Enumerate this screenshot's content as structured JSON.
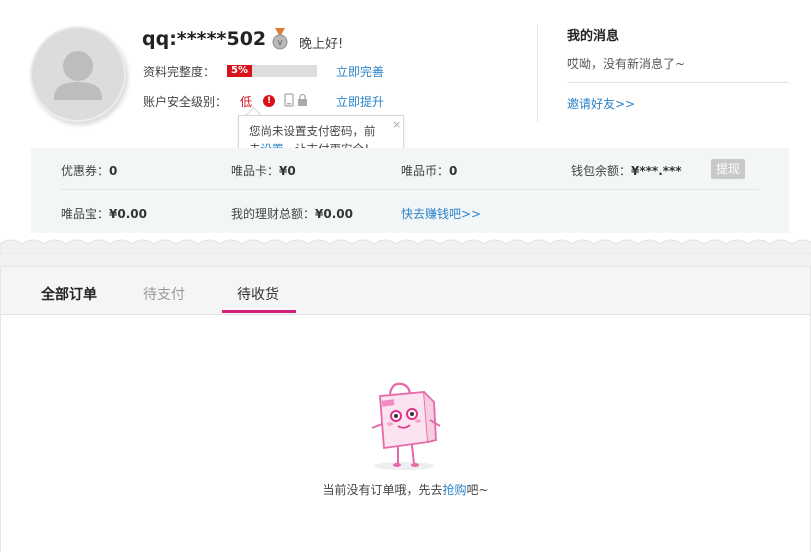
{
  "profile": {
    "username": "qq:*****502",
    "greeting": "晚上好!",
    "completeness_label": "资料完整度：",
    "completeness_percent_text": "5%",
    "completeness_fraction": 0.05,
    "complete_link": "立即完善",
    "security_label": "账户安全级别：",
    "security_level": "低",
    "upgrade_link": "立即提升"
  },
  "tooltip": {
    "line1": "您尚未设置支付密码，前",
    "line2_prefix": "去",
    "line2_link": "设置",
    "line2_suffix": "，让支付更安全！",
    "close": "×"
  },
  "messages": {
    "title": "我的消息",
    "empty": "哎呦，没有新消息了~",
    "invite": "邀请好友>>"
  },
  "account": {
    "coupon_label": "优惠券：",
    "coupon_value": "0",
    "card_label": "唯品卡：",
    "card_value": "¥0",
    "coin_label": "唯品币：",
    "coin_value": "0",
    "wallet_label": "钱包余额：",
    "wallet_value": "¥***.***",
    "withdraw": "提现",
    "vpbao_label": "唯品宝：",
    "vpbao_value": "¥0.00",
    "finance_label": "我的理财总额：",
    "finance_value": "¥0.00",
    "earn_link": "快去赚钱吧>>"
  },
  "orders": {
    "tabs": [
      "全部订单",
      "待支付",
      "待收货"
    ],
    "empty_prefix": "当前没有订单哦，先去",
    "empty_link": "抢购",
    "empty_suffix": "吧~"
  },
  "colors": {
    "accent": "#d2227c",
    "link": "#2b83c9",
    "danger": "#d8111b"
  }
}
